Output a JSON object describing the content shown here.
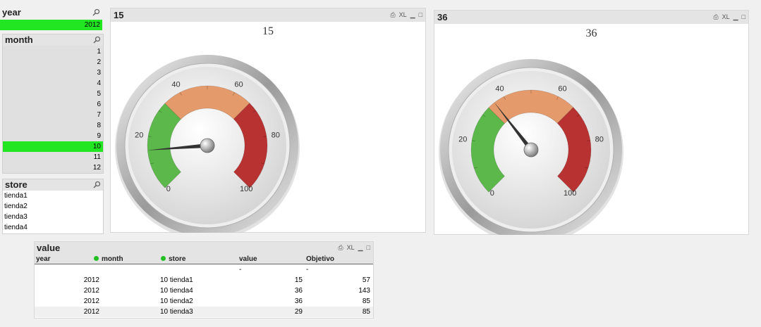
{
  "year_listbox": {
    "title": "year",
    "items": [
      "2012"
    ],
    "selected": "2012"
  },
  "month_listbox": {
    "title": "month",
    "items": [
      "1",
      "2",
      "3",
      "4",
      "5",
      "6",
      "7",
      "8",
      "9",
      "10",
      "11",
      "12"
    ],
    "selected": "10"
  },
  "store_listbox": {
    "title": "store",
    "items": [
      "tienda1",
      "tienda2",
      "tienda3",
      "tienda4"
    ]
  },
  "gauge1": {
    "caption": "15",
    "title": "15",
    "value": 15,
    "ticks": [
      "0",
      "20",
      "40",
      "60",
      "80",
      "100"
    ]
  },
  "gauge2": {
    "caption": "36",
    "title": "36",
    "value": 36,
    "ticks": [
      "0",
      "20",
      "40",
      "60",
      "80",
      "100"
    ]
  },
  "caption_icons": {
    "print": "⎙",
    "xl": "XL",
    "minimize": "▁",
    "maximize": "□"
  },
  "colors": {
    "green": "#5cb84a",
    "orange": "#e49a6a",
    "red": "#b83232",
    "selected": "#22e622"
  },
  "value_table": {
    "title": "value",
    "columns": [
      "year",
      "month",
      "store",
      "value",
      "Objetivo"
    ],
    "totals": {
      "value": "-",
      "objetivo": "-"
    },
    "rows": [
      {
        "year": "2012",
        "month_store": "10 tienda1",
        "value": "15",
        "objetivo": "57"
      },
      {
        "year": "2012",
        "month_store": "10 tienda4",
        "value": "36",
        "objetivo": "143"
      },
      {
        "year": "2012",
        "month_store": "10 tienda2",
        "value": "36",
        "objetivo": "85"
      },
      {
        "year": "2012",
        "month_store": "10 tienda3",
        "value": "29",
        "objetivo": "85"
      }
    ]
  }
}
